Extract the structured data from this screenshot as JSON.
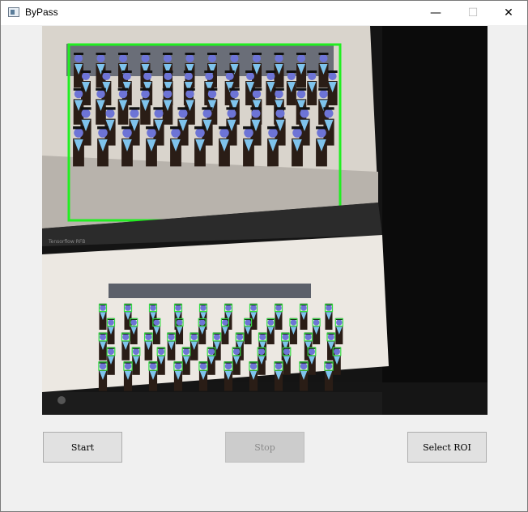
{
  "window": {
    "title": "ByPass"
  },
  "title_controls": {
    "minimize_glyph": "—",
    "maximize_glyph": "☐",
    "close_glyph": "✕"
  },
  "buttons": {
    "start": "Start",
    "stop": "Stop",
    "select_roi": "Select ROI"
  },
  "video": {
    "screen_caption": "Tensorflow RFB"
  },
  "colors": {
    "roi_box": "#22ee22",
    "face_box": "#33dd44",
    "gown": "#2a1d16",
    "stole": "#7ec3ec"
  }
}
